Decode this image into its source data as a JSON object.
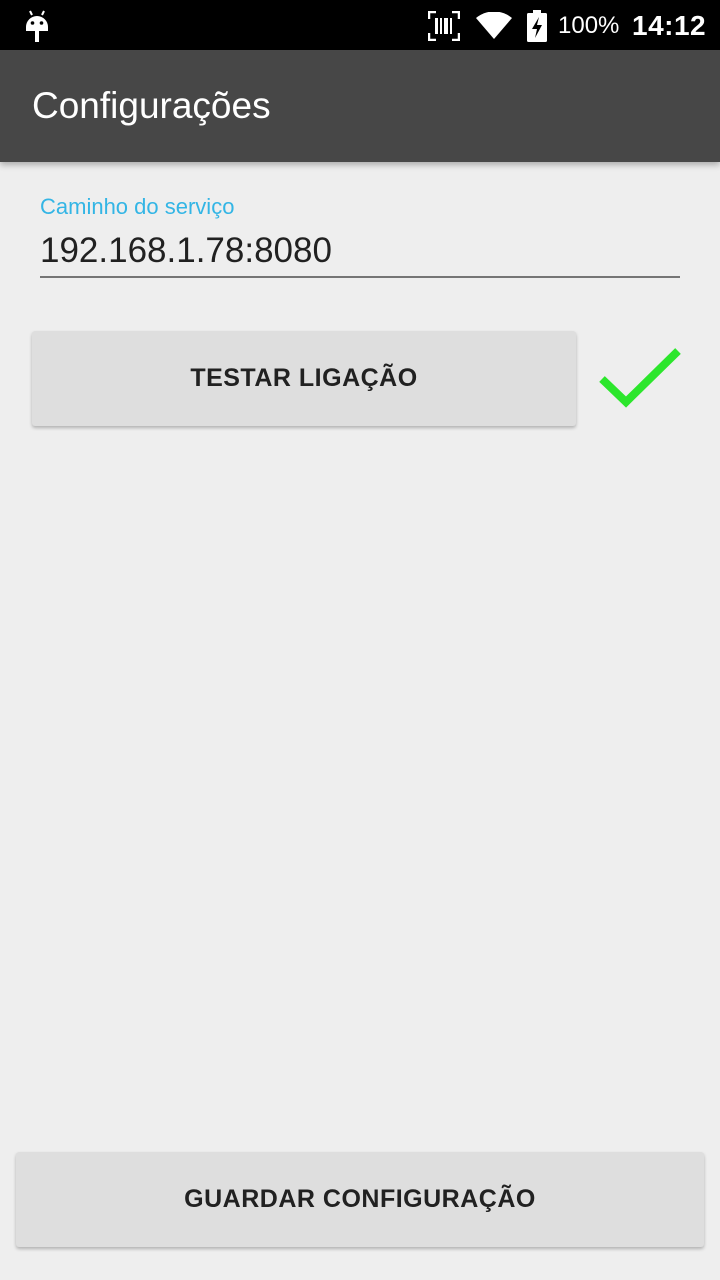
{
  "status_bar": {
    "icons": [
      "android-icon",
      "barcode-scanner-icon",
      "wifi-icon",
      "battery-charging-icon"
    ],
    "battery": "100%",
    "time": "14:12"
  },
  "app_bar": {
    "title": "Configurações"
  },
  "service_field": {
    "label": "Caminho do serviço",
    "value": "192.168.1.78:8080"
  },
  "test_button": {
    "label": "TESTAR LIGAÇÃO"
  },
  "test_status": {
    "icon": "checkmark-icon",
    "color": "#2ce62c"
  },
  "save_button": {
    "label": "GUARDAR CONFIGURAÇÃO"
  },
  "colors": {
    "status_bar": "#000000",
    "app_bar": "#474747",
    "background": "#eeeeee",
    "accent": "#33b5e5",
    "button": "#dedede"
  }
}
